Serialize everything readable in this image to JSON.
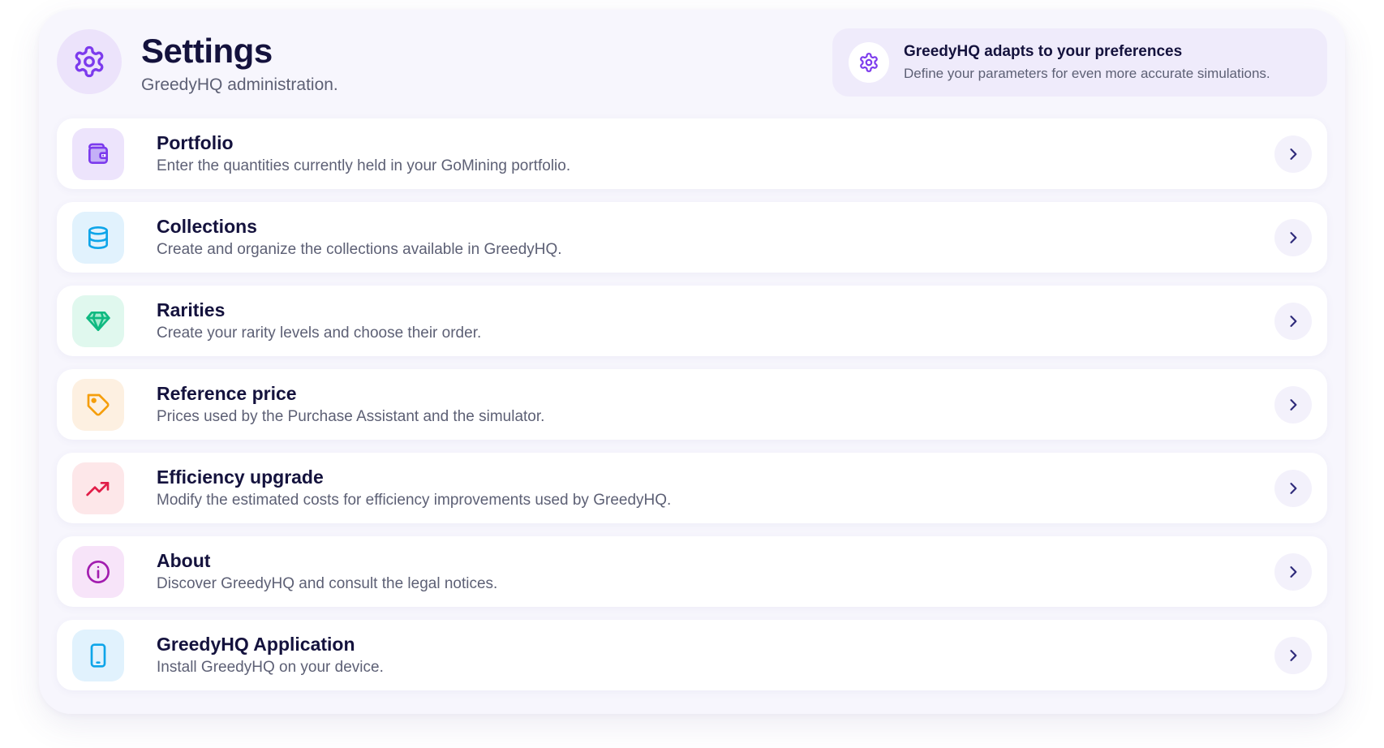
{
  "header": {
    "title": "Settings",
    "subtitle": "GreedyHQ administration.",
    "icon": "gear-icon",
    "promo": {
      "icon": "gear-icon",
      "title": "GreedyHQ adapts to your preferences",
      "text": "Define your parameters for even more accurate simulations."
    }
  },
  "items": [
    {
      "id": "portfolio",
      "title": "Portfolio",
      "description": "Enter the quantities currently held in your GoMining portfolio.",
      "icon": "wallet-icon",
      "icon_color": "#7c3aed",
      "icon_bg": "#ede4fc"
    },
    {
      "id": "collections",
      "title": "Collections",
      "description": "Create and organize the collections available in GreedyHQ.",
      "icon": "database-icon",
      "icon_color": "#0ea5e9",
      "icon_bg": "#e1f2fd"
    },
    {
      "id": "rarities",
      "title": "Rarities",
      "description": "Create your rarity levels and choose their order.",
      "icon": "diamond-icon",
      "icon_color": "#10b981",
      "icon_bg": "#e0f8ee"
    },
    {
      "id": "reference-price",
      "title": "Reference price",
      "description": "Prices used by the Purchase Assistant and the simulator.",
      "icon": "price-tag-icon",
      "icon_color": "#f59e0b",
      "icon_bg": "#fdf0e1"
    },
    {
      "id": "efficiency-upgrade",
      "title": "Efficiency upgrade",
      "description": "Modify the estimated costs for efficiency improvements used by GreedyHQ.",
      "icon": "trending-up-icon",
      "icon_color": "#e11d48",
      "icon_bg": "#fde7e9"
    },
    {
      "id": "about",
      "title": "About",
      "description": "Discover GreedyHQ and consult the legal notices.",
      "icon": "info-icon",
      "icon_color": "#a21caf",
      "icon_bg": "#f7e4f9"
    },
    {
      "id": "application",
      "title": "GreedyHQ Application",
      "description": "Install GreedyHQ on your device.",
      "icon": "smartphone-icon",
      "icon_color": "#0ea5e9",
      "icon_bg": "#e1f2fd"
    }
  ],
  "colors": {
    "accent": "#7c3aed",
    "text_primary": "#14123d",
    "text_secondary": "#5d6075",
    "chevron": "#2e2a7a"
  }
}
